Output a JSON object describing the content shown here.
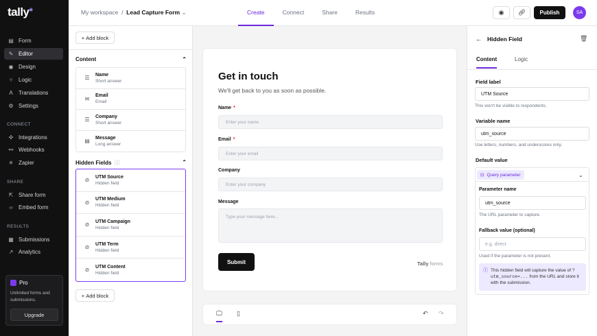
{
  "app": {
    "logo": "tally",
    "logo_star": "*"
  },
  "sidebar": {
    "items": [
      {
        "label": "Form",
        "icon": "form-icon",
        "glyph": "▤"
      },
      {
        "label": "Editor",
        "icon": "editor-icon",
        "glyph": "✎"
      },
      {
        "label": "Design",
        "icon": "design-icon",
        "glyph": "◉"
      },
      {
        "label": "Logic",
        "icon": "logic-icon",
        "glyph": "⑂"
      },
      {
        "label": "Translations",
        "icon": "translations-icon",
        "glyph": "A"
      },
      {
        "label": "Settings",
        "icon": "settings-icon",
        "glyph": "⚙"
      }
    ],
    "connect_heading": "CONNECT",
    "connect_items": [
      {
        "label": "Integrations",
        "icon": "integrations-icon",
        "glyph": "✣"
      },
      {
        "label": "Webhooks",
        "icon": "webhooks-icon",
        "glyph": "⚯"
      },
      {
        "label": "Zapier",
        "icon": "zapier-icon",
        "glyph": "✳"
      }
    ],
    "share_heading": "SHARE",
    "share_items": [
      {
        "label": "Share form",
        "icon": "share-icon",
        "glyph": "⇱"
      },
      {
        "label": "Embed form",
        "icon": "embed-icon",
        "glyph": "‹›"
      }
    ],
    "results_heading": "RESULTS",
    "results_items": [
      {
        "label": "Submissions",
        "icon": "submissions-icon",
        "glyph": "▦"
      },
      {
        "label": "Analytics",
        "icon": "analytics-icon",
        "glyph": "📈"
      }
    ],
    "pro": {
      "title": "Pro",
      "desc": "Unlimited forms and submissions.",
      "button": "Upgrade"
    }
  },
  "topbar": {
    "workspace": "My workspace",
    "separator": "/",
    "form_name": "Lead Capture Form",
    "tabs": [
      "Create",
      "Connect",
      "Share",
      "Results"
    ],
    "active_tab": "Create",
    "publish": "Publish",
    "avatar": "SA"
  },
  "blocks": {
    "add_block": "Add block",
    "content_heading": "Content",
    "content_items": [
      {
        "name": "Name",
        "type": "Short answer",
        "icon": "short-answer-icon",
        "glyph": "☰"
      },
      {
        "name": "Email",
        "type": "Email",
        "icon": "email-icon",
        "glyph": "✉"
      },
      {
        "name": "Company",
        "type": "Short answer",
        "icon": "short-answer-icon",
        "glyph": "☰"
      },
      {
        "name": "Message",
        "type": "Long answer",
        "icon": "long-answer-icon",
        "glyph": "▤"
      }
    ],
    "hidden_heading": "Hidden Fields",
    "hidden_items": [
      {
        "name": "UTM Source",
        "type": "Hidden field"
      },
      {
        "name": "UTM Medium",
        "type": "Hidden field"
      },
      {
        "name": "UTM Campaign",
        "type": "Hidden field"
      },
      {
        "name": "UTM Term",
        "type": "Hidden field"
      },
      {
        "name": "UTM Content",
        "type": "Hidden field"
      }
    ]
  },
  "form": {
    "title": "Get in touch",
    "subtitle": "We'll get back to you as soon as possible.",
    "fields": [
      {
        "label": "Name",
        "required": "*",
        "placeholder": "Enter your name"
      },
      {
        "label": "Email",
        "required": "*",
        "placeholder": "Enter your email"
      },
      {
        "label": "Company",
        "required": "",
        "placeholder": "Enter your company"
      },
      {
        "label": "Message",
        "required": "",
        "placeholder": "Type your message here..."
      }
    ],
    "submit": "Submit",
    "brand_a": "Tally",
    "brand_b": " forms"
  },
  "panel": {
    "title": "Hidden Field",
    "tabs": [
      "Content",
      "Logic"
    ],
    "field_label_title": "Field label",
    "field_label_value": "UTM Source",
    "field_label_hint": "This won't be visible to respondents.",
    "variable_title": "Variable name",
    "variable_value": "utm_source",
    "variable_hint": "Use letters, numbers, and underscores only.",
    "default_title": "Default value",
    "default_type": "Query parameter",
    "param_title": "Parameter name",
    "param_value": "utm_source",
    "param_hint": "The URL parameter to capture.",
    "fallback_title": "Fallback value (optional)",
    "fallback_placeholder": "e.g. direct",
    "fallback_hint": "Used if the parameter is not present.",
    "info_a": "This hidden field will capture the value of ",
    "info_code": "?utm_source=...",
    "info_b": " from the URL and store it with the submission."
  }
}
